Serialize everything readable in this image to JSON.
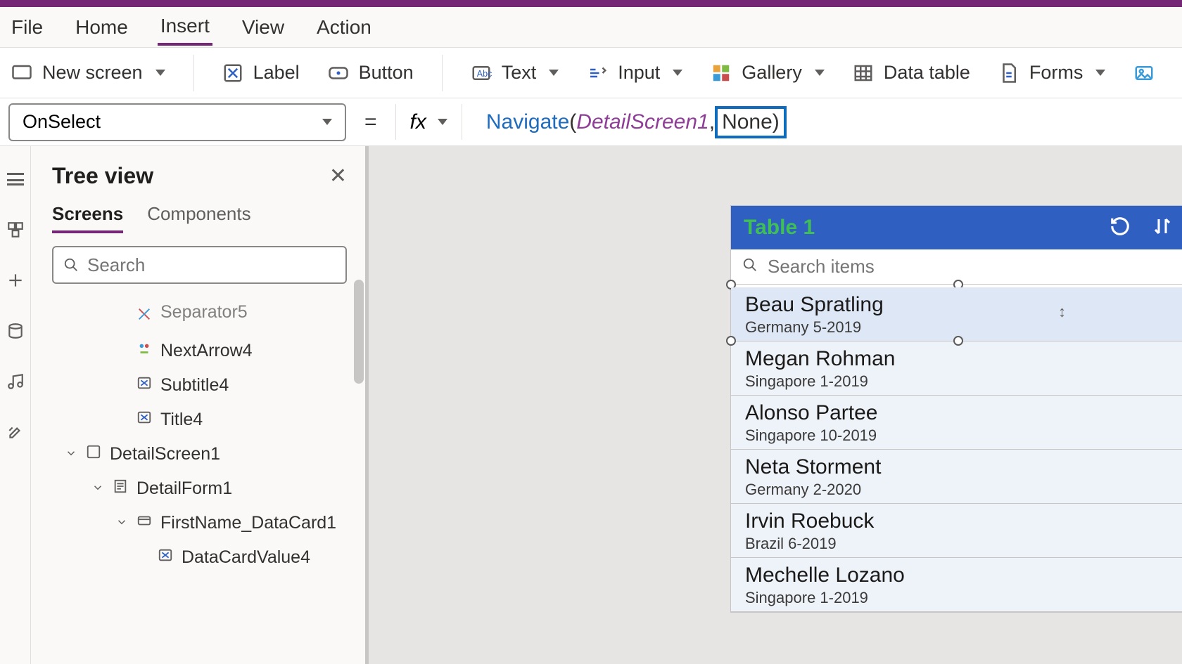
{
  "menubar": {
    "tabs": [
      {
        "label": "File"
      },
      {
        "label": "Home"
      },
      {
        "label": "Insert",
        "active": true
      },
      {
        "label": "View"
      },
      {
        "label": "Action"
      }
    ]
  },
  "ribbon": {
    "new_screen": "New screen",
    "label": "Label",
    "button": "Button",
    "text": "Text",
    "input": "Input",
    "gallery": "Gallery",
    "data_table": "Data table",
    "forms": "Forms"
  },
  "formula": {
    "property": "OnSelect",
    "fx": "fx",
    "fn": "Navigate",
    "open": "(",
    "arg1": "DetailScreen1",
    "comma": ", ",
    "arg2_highlight": "None)",
    "equals": "="
  },
  "tree": {
    "title": "Tree view",
    "tabs": {
      "screens": "Screens",
      "components": "Components"
    },
    "search_placeholder": "Search",
    "items": [
      {
        "level": "lvl1",
        "icon": "separator",
        "label": "Separator5",
        "cut": true
      },
      {
        "level": "lvl1",
        "icon": "nextarrow",
        "label": "NextArrow4"
      },
      {
        "level": "lvl1",
        "icon": "label",
        "label": "Subtitle4"
      },
      {
        "level": "lvl1",
        "icon": "label",
        "label": "Title4"
      },
      {
        "level": "lvl-root",
        "icon": "screen",
        "label": "DetailScreen1",
        "caret": true
      },
      {
        "level": "lvl-form",
        "icon": "form",
        "label": "DetailForm1",
        "caret": true
      },
      {
        "level": "lvl-card",
        "icon": "card",
        "label": "FirstName_DataCard1",
        "caret": true
      },
      {
        "level": "lvl-val",
        "icon": "label",
        "label": "DataCardValue4"
      }
    ]
  },
  "preview": {
    "title": "Table 1",
    "search_placeholder": "Search items",
    "rows": [
      {
        "main": "Beau Spratling",
        "sub": "Germany 5-2019",
        "selected": true
      },
      {
        "main": "Megan Rohman",
        "sub": "Singapore 1-2019"
      },
      {
        "main": "Alonso Partee",
        "sub": "Singapore 10-2019"
      },
      {
        "main": "Neta Storment",
        "sub": "Germany 2-2020"
      },
      {
        "main": "Irvin Roebuck",
        "sub": "Brazil 6-2019"
      },
      {
        "main": "Mechelle Lozano",
        "sub": "Singapore 1-2019"
      }
    ]
  }
}
